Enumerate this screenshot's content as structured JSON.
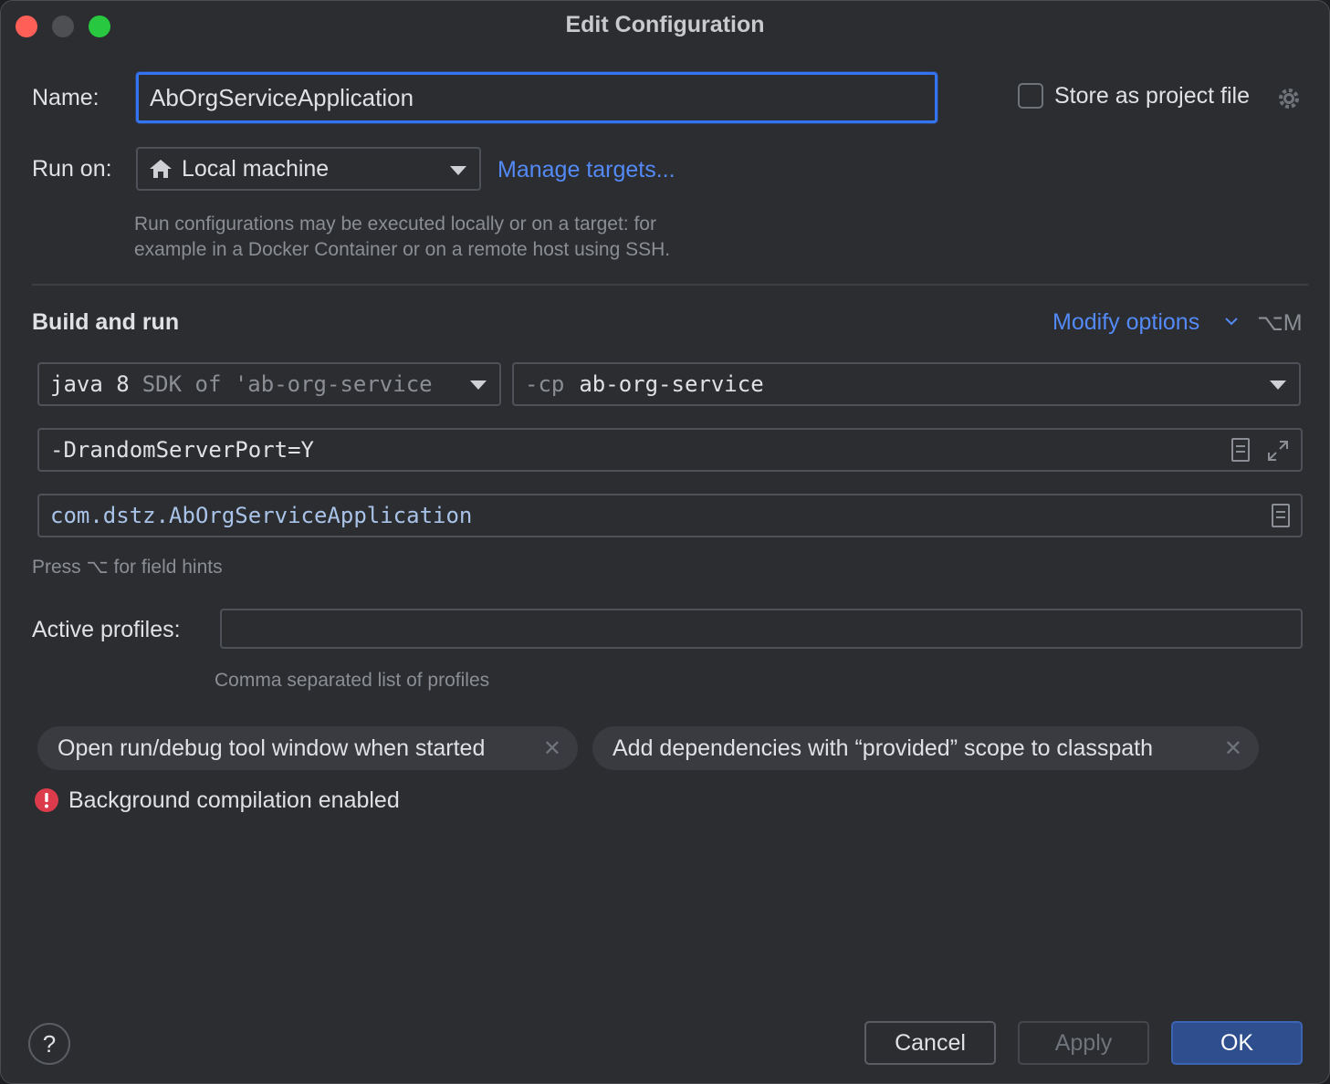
{
  "window": {
    "title": "Edit Configuration"
  },
  "name": {
    "label": "Name:",
    "value": "AbOrgServiceApplication"
  },
  "store": {
    "label": "Store as project file"
  },
  "run_on": {
    "label": "Run on:",
    "value": "Local machine",
    "manage_link": "Manage targets...",
    "hint_line1": "Run configurations may be executed locally or on a target: for",
    "hint_line2": "example in a Docker Container or on a remote host using SSH."
  },
  "build_run": {
    "heading": "Build and run",
    "modify_options": "Modify options",
    "modify_shortcut": "⌥M",
    "jre_main": "java 8",
    "jre_dim": "SDK of 'ab-org-service",
    "cp_flag": "-cp",
    "cp_value": "ab-org-service",
    "vm_options": "-DrandomServerPort=Y",
    "main_class": "com.dstz.AbOrgServiceApplication",
    "field_hint": "Press ⌥ for field hints"
  },
  "profiles": {
    "label": "Active profiles:",
    "value": "",
    "hint": "Comma separated list of profiles"
  },
  "chips": [
    {
      "label": "Open run/debug tool window when started"
    },
    {
      "label": "Add dependencies with “provided” scope to classpath"
    }
  ],
  "warning": {
    "text": "Background compilation enabled"
  },
  "buttons": {
    "help": "?",
    "cancel": "Cancel",
    "apply": "Apply",
    "ok": "OK"
  },
  "colors": {
    "accent": "#3574f0",
    "link": "#548af7",
    "error": "#db3b4b",
    "background": "#2b2d30"
  }
}
